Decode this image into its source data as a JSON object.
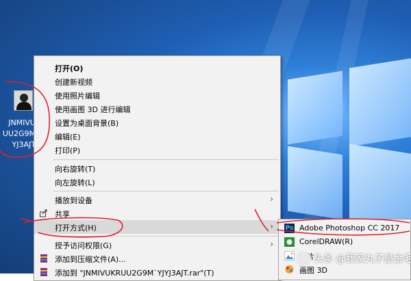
{
  "desktop": {
    "file_icon_label": [
      "JNMIVU",
      "UU2G9M",
      "YJ3AJT"
    ]
  },
  "context_menu": {
    "items": [
      {
        "label": "打开(O)",
        "bold": true
      },
      {
        "label": "创建新视频"
      },
      {
        "label": "使用照片编辑"
      },
      {
        "label": "使用画图 3D 进行编辑"
      },
      {
        "label": "设置为桌面背景(B)"
      },
      {
        "label": "编辑(E)"
      },
      {
        "label": "打印(P)"
      },
      {
        "label": "向右旋转(T)"
      },
      {
        "label": "向左旋转(L)"
      },
      {
        "label": "播放到设备",
        "has_submenu": true
      },
      {
        "label": "共享",
        "icon": "share-icon"
      },
      {
        "label": "打开方式(H)",
        "has_submenu": true,
        "highlighted": true
      },
      {
        "label": "授予访问权限(G)",
        "has_submenu": true
      },
      {
        "label": "添加到压缩文件(A)...",
        "icon": "winrar-icon"
      },
      {
        "label": "添加到 \"JNMIVUKRUU2G9M`YJYJ3AJT.rar\"(T)",
        "icon": "winrar-icon"
      }
    ]
  },
  "open_with_submenu": {
    "items": [
      {
        "label": "Adobe Photoshop CC 2017",
        "icon": "photoshop-icon",
        "icon_text": "Ps"
      },
      {
        "label": "CorelDRAW(R)",
        "icon": "coreldraw-icon"
      },
      {
        "label": "照片",
        "icon": "photos-icon"
      },
      {
        "label": "画图 3D",
        "icon": "paint3d-icon"
      }
    ]
  },
  "watermark": {
    "text": "头条 @我家丸子是金毛"
  },
  "colors": {
    "annotation_red": "#e0202a",
    "menu_bg": "#f2f2f2",
    "highlight_bg": "#d9d9d9"
  }
}
